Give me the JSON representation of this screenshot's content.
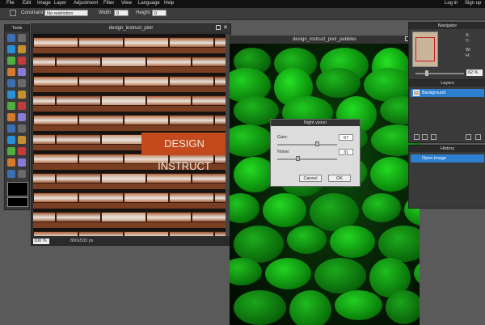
{
  "menubar": {
    "items": [
      "File",
      "Edit",
      "Image",
      "Layer",
      "Adjustment",
      "Filter",
      "View",
      "Language",
      "Help"
    ],
    "login": "Log in",
    "signup": "Sign up"
  },
  "optionsbar": {
    "constraint_label": "Constraint:",
    "constraint_value": "No restriction",
    "width_label": "Width:",
    "width_value": "0",
    "height_label": "Height:",
    "height_value": "0"
  },
  "tools": {
    "title": "Tools",
    "items": [
      "crop-icon",
      "move-icon",
      "marquee-icon",
      "lasso-icon",
      "wand-icon",
      "pencil-icon",
      "brush-icon",
      "clone-icon",
      "color-replace-icon",
      "drawing-icon",
      "gradient-icon",
      "fill-icon",
      "eraser-icon",
      "sponge-icon",
      "blur-icon",
      "sharpen-icon",
      "smudge-icon",
      "burn-icon",
      "dodge-icon",
      "redeye-icon",
      "bloat-icon",
      "pinch-icon",
      "text-icon",
      "picker-icon",
      "hand-icon",
      "zoom-icon"
    ]
  },
  "doc1": {
    "title": "design_instruct_pixlr",
    "zoom": "100",
    "zoom_unit": "%",
    "size": "800x533 px",
    "overlay_text": "DESIGN INSTRUCT"
  },
  "doc2": {
    "title": "design_instruct_pixlr_pebbles"
  },
  "dialog": {
    "title": "Night vision",
    "gain_label": "Gain:",
    "gain_value": "67",
    "noise_label": "Noise:",
    "noise_value": "31",
    "cancel_label": "Cancel",
    "ok_label": "OK",
    "gain_fraction": 0.67,
    "noise_fraction": 0.31
  },
  "navigator": {
    "title": "Navigator",
    "x_label": "X:",
    "y_label": "Y:",
    "w_label": "W:",
    "h_label": "H:",
    "zoom": "62",
    "zoom_unit": "%"
  },
  "layers": {
    "title": "Layers",
    "items": [
      "Background"
    ]
  },
  "history": {
    "title": "History",
    "items": [
      "Open image"
    ]
  },
  "colors": {
    "selection": "#2d7fcf",
    "dialog_bg": "#dcdcdc",
    "brick": "#b0653c",
    "pebble": "#24a824"
  }
}
